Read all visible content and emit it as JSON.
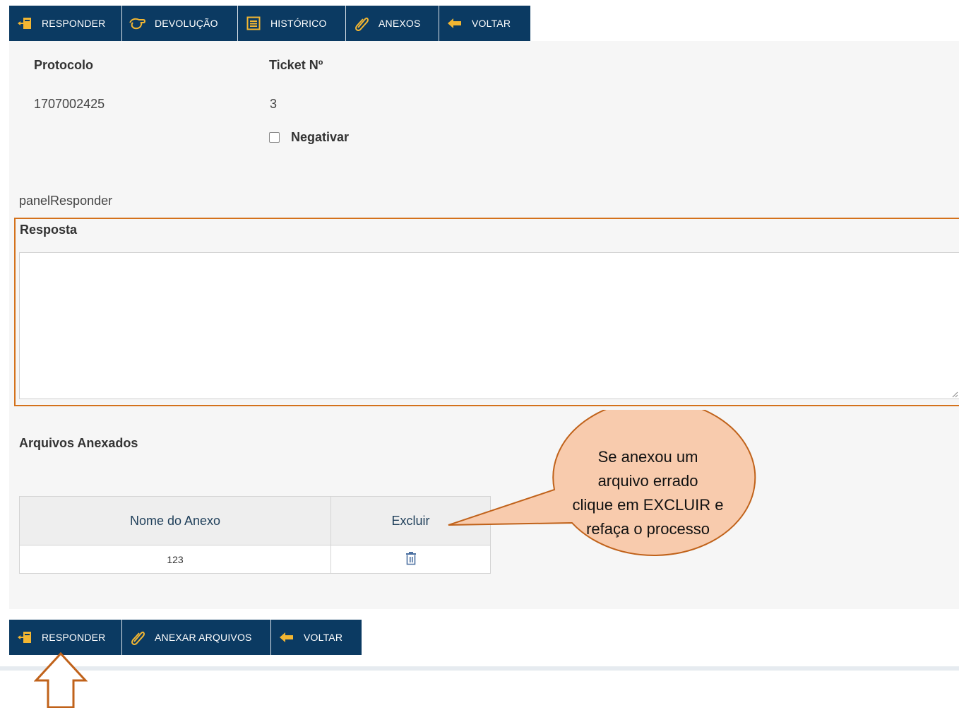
{
  "toolbar_top": [
    {
      "label": "RESPONDER",
      "icon": "reply-icon"
    },
    {
      "label": "DEVOLUÇÃO",
      "icon": "return-hand-icon"
    },
    {
      "label": "HISTÓRICO",
      "icon": "list-icon"
    },
    {
      "label": "ANEXOS",
      "icon": "paperclip-icon"
    },
    {
      "label": "VOLTAR",
      "icon": "arrow-left-icon"
    }
  ],
  "info": {
    "protocolo_label": "Protocolo",
    "protocolo_value": "1707002425",
    "ticket_label": "Ticket Nº",
    "ticket_value": "3",
    "negativar_label": "Negativar",
    "negativar_checked": false
  },
  "panel_name": "panelResponder",
  "resposta": {
    "label": "Resposta",
    "value": ""
  },
  "anexos": {
    "title": "Arquivos Anexados",
    "headers": [
      "Nome do Anexo",
      "Excluir"
    ],
    "rows": [
      {
        "nome": "123",
        "excluir_icon": "trash-icon"
      }
    ]
  },
  "callout": {
    "text": "Se anexou um arquivo errado clique em EXCLUIR e refaça o processo",
    "lines": [
      "Se anexou um",
      "arquivo errado",
      "clique em EXCLUIR e",
      "refaça o processo"
    ]
  },
  "toolbar_bottom": [
    {
      "label": "RESPONDER",
      "icon": "reply-icon"
    },
    {
      "label": "ANEXAR ARQUIVOS",
      "icon": "paperclip-icon"
    },
    {
      "label": "VOLTAR",
      "icon": "arrow-left-icon"
    }
  ],
  "colors": {
    "toolbar_bg": "#0b3a62",
    "icon_yellow": "#f2b632",
    "highlight_orange": "#d4721c",
    "callout_fill": "#f8cbad",
    "arrow_color": "#c0621a"
  }
}
